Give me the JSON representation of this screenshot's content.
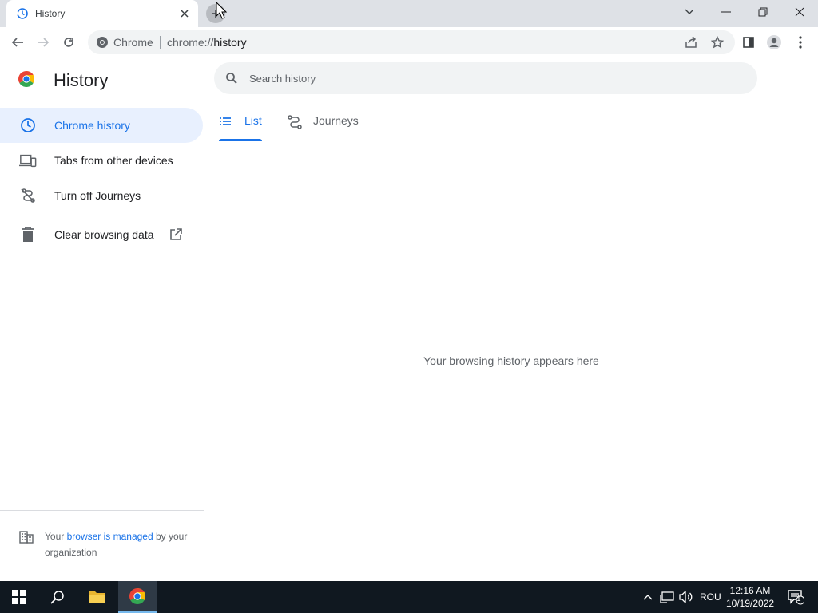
{
  "tab": {
    "title": "History"
  },
  "toolbar": {
    "site_chip": "Chrome",
    "url_scheme": "chrome://",
    "url_path": "history"
  },
  "page": {
    "title": "History",
    "search_placeholder": "Search history",
    "empty_message": "Your browsing history appears here"
  },
  "sidebar": {
    "items": [
      {
        "label": "Chrome history",
        "icon": "clock-icon"
      },
      {
        "label": "Tabs from other devices",
        "icon": "devices-icon"
      },
      {
        "label": "Turn off Journeys",
        "icon": "journeys-off-icon"
      },
      {
        "label": "Clear browsing data",
        "icon": "trash-icon"
      }
    ],
    "managed": {
      "prefix": "Your ",
      "link": "browser is managed",
      "suffix": " by your organization"
    }
  },
  "content_tabs": [
    {
      "label": "List",
      "icon": "list-icon"
    },
    {
      "label": "Journeys",
      "icon": "journeys-icon"
    }
  ],
  "taskbar": {
    "language": "ROU",
    "time": "12:16 AM",
    "date": "10/19/2022",
    "notifications": "1"
  },
  "colors": {
    "accent": "#1a73e8",
    "active_bg": "#e8f0fe",
    "taskbar": "#101820"
  }
}
